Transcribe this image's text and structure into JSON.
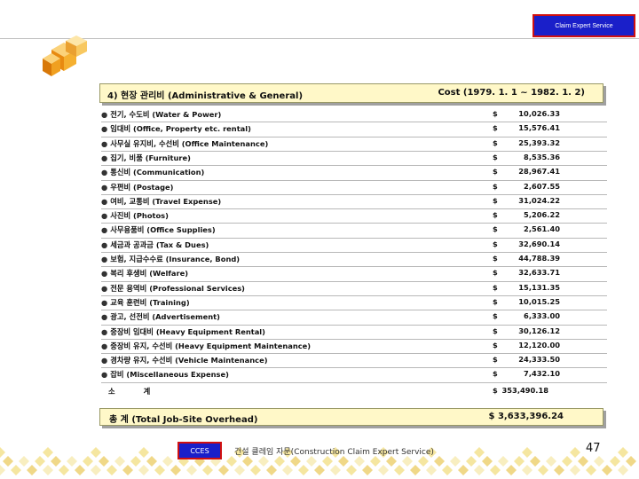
{
  "header": {
    "badge_text": "Claim Expert Service",
    "title": "4) 현장 관리비 (Administrative & General)",
    "cost_heading": "Cost (1979. 1. 1 ~ 1982. 1. 2)"
  },
  "items": [
    {
      "label": "전기, 수도비 (Water & Power)",
      "currency": "$",
      "amount": "10,026.33"
    },
    {
      "label": "임대비 (Office, Property etc. rental)",
      "currency": "$",
      "amount": "15,576.41"
    },
    {
      "label": "사무실 유지비, 수선비 (Office Maintenance)",
      "currency": "$",
      "amount": "25,393.32"
    },
    {
      "label": "집기, 비품 (Furniture)",
      "currency": "$",
      "amount": "8,535.36"
    },
    {
      "label": "통신비 (Communication)",
      "currency": "$",
      "amount": "28,967.41"
    },
    {
      "label": "우편비 (Postage)",
      "currency": "$",
      "amount": "2,607.55"
    },
    {
      "label": "여비, 교통비 (Travel Expense)",
      "currency": "$",
      "amount": "31,024.22"
    },
    {
      "label": "사진비 (Photos)",
      "currency": "$",
      "amount": "5,206.22"
    },
    {
      "label": "사무용품비 (Office Supplies)",
      "currency": "$",
      "amount": "2,561.40"
    },
    {
      "label": "세금과 공과금 (Tax & Dues)",
      "currency": "$",
      "amount": "32,690.14"
    },
    {
      "label": "보험, 지급수수료 (Insurance, Bond)",
      "currency": "$",
      "amount": "44,788.39"
    },
    {
      "label": "복리 후생비 (Welfare)",
      "currency": "$",
      "amount": "32,633.71"
    },
    {
      "label": "전문 용역비 (Professional Services)",
      "currency": "$",
      "amount": "15,131.35"
    },
    {
      "label": "교육 훈련비 (Training)",
      "currency": "$",
      "amount": "10,015.25"
    },
    {
      "label": "광고, 선전비 (Advertisement)",
      "currency": "$",
      "amount": "6,333.00"
    },
    {
      "label": "중장비 임대비 (Heavy Equipment Rental)",
      "currency": "$",
      "amount": "30,126.12"
    },
    {
      "label": "중장비 유지, 수선비 (Heavy Equipment Maintenance)",
      "currency": "$",
      "amount": "12,120.00"
    },
    {
      "label": "경차량 유지, 수선비 (Vehicle Maintenance)",
      "currency": "$",
      "amount": "24,333.50"
    },
    {
      "label": "잡비 (Miscellaneous Expense)",
      "currency": "$",
      "amount": "7,432.10"
    }
  ],
  "subtotal": {
    "label": "소계",
    "currency": "$",
    "amount": "353,490.18"
  },
  "total": {
    "label": "총     계  (Total Job-Site Overhead)",
    "amount": "$  3,633,396.24"
  },
  "footer": {
    "logo_text": "CCES",
    "org_text": "건설 클레임 자문(Construction Claim Expert Service)",
    "page_number": "47"
  },
  "colors": {
    "badge_bg": "#1a1fc9",
    "badge_border": "#d01010",
    "panel_bg": "#fff8c8",
    "cube_orange": "#f0a020",
    "diamond_yellow": "#f5e6a0"
  }
}
